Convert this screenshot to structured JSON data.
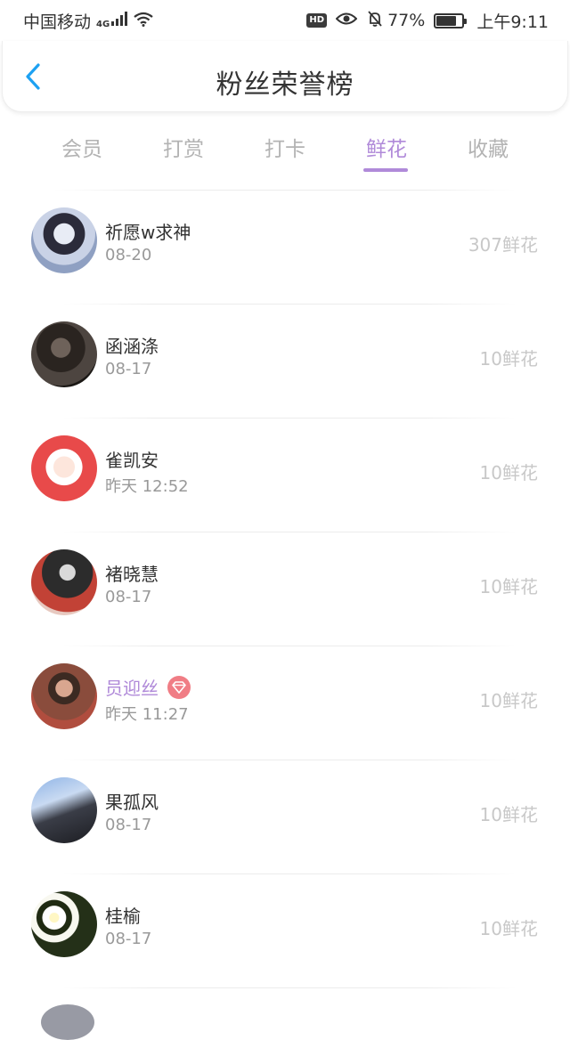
{
  "status_bar": {
    "carrier": "中国移动",
    "network": "4G",
    "hd_label": "HD",
    "battery_percent": "77%",
    "battery_level": 0.77,
    "time": "上午9:11"
  },
  "header": {
    "title": "粉丝荣誉榜",
    "back_icon": "chevron-left-icon",
    "accent_color": "#1da1f2"
  },
  "tabs": [
    {
      "label": "会员",
      "active": false
    },
    {
      "label": "打赏",
      "active": false
    },
    {
      "label": "打卡",
      "active": false
    },
    {
      "label": "鲜花",
      "active": true
    },
    {
      "label": "收藏",
      "active": false
    }
  ],
  "colors": {
    "active_tab": "#b08ad9",
    "vip_name": "#b08ad9",
    "vip_badge": "#f07d85",
    "amount_text": "#c8c8c8",
    "date_text": "#999999"
  },
  "fans": [
    {
      "name": "祈愿w求神",
      "date": "08-20",
      "amount": "307鲜花",
      "vip": false
    },
    {
      "name": "函涵涤",
      "date": "08-17",
      "amount": "10鲜花",
      "vip": false
    },
    {
      "name": "雀凯安",
      "date": "昨天 12:52",
      "amount": "10鲜花",
      "vip": false
    },
    {
      "name": "褚晓慧",
      "date": "08-17",
      "amount": "10鲜花",
      "vip": false
    },
    {
      "name": "员迎丝",
      "date": "昨天 11:27",
      "amount": "10鲜花",
      "vip": true
    },
    {
      "name": "果孤风",
      "date": "08-17",
      "amount": "10鲜花",
      "vip": false
    },
    {
      "name": "桂榆",
      "date": "08-17",
      "amount": "10鲜花",
      "vip": false
    }
  ]
}
